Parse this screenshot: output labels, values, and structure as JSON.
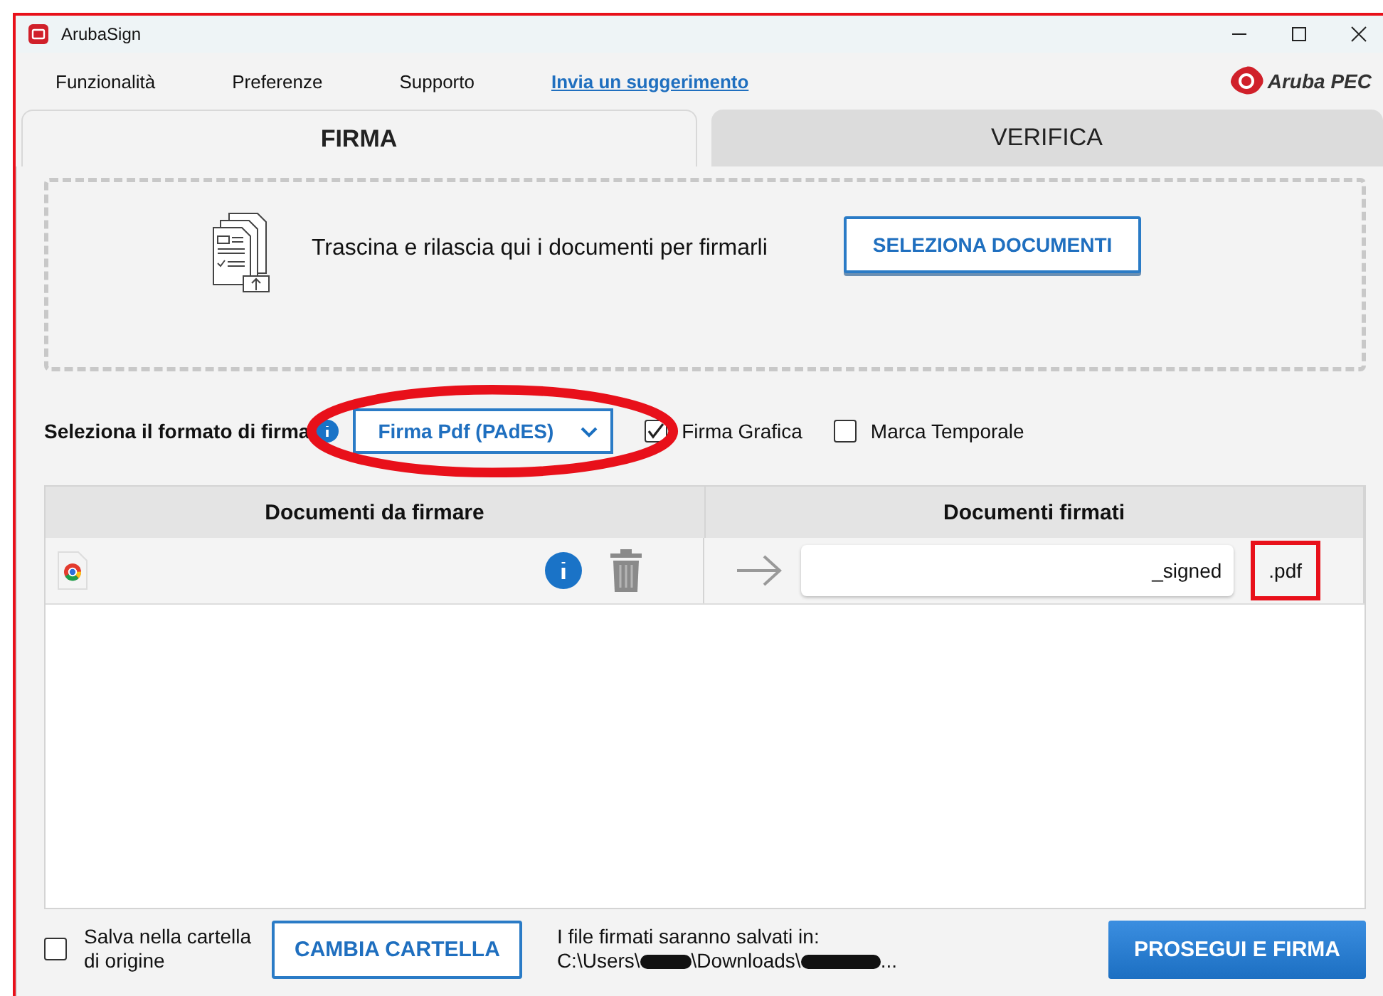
{
  "window": {
    "title": "ArubaSign"
  },
  "menu": [
    "Funzionalità",
    "Preferenze",
    "Supporto"
  ],
  "suggestion_link": "Invia un suggerimento",
  "logo": "Aruba PEC",
  "tabs": [
    {
      "label": "FIRMA",
      "selected": true
    },
    {
      "label": "VERIFICA",
      "selected": false
    }
  ],
  "drop_zone": {
    "text": "Trascina e rilascia qui i documenti per firmarli",
    "button": "SELEZIONA DOCUMENTI"
  },
  "format": {
    "label": "Seleziona il formato di firma",
    "value": "Firma Pdf (PAdES)",
    "highlighted": true
  },
  "options": [
    {
      "label": "Firma Grafica",
      "checked": true
    },
    {
      "label": "Marca Temporale",
      "checked": false
    }
  ],
  "table": {
    "columns": [
      "Documenti da firmare",
      "Documenti firmati"
    ],
    "rows": [
      {
        "suffix": "_signed",
        "extension": ".pdf",
        "extension_highlighted": true
      }
    ]
  },
  "footer": {
    "save_label": "Salva nella cartella di origine",
    "save_checked": false,
    "change_button": "CAMBIA CARTELLA",
    "path_label": "I file firmati saranno salvati in:",
    "path_parts": [
      "C:\\Users\\",
      "\\Downloads\\",
      "..."
    ],
    "sign_button": "PROSEGUI E FIRMA"
  }
}
